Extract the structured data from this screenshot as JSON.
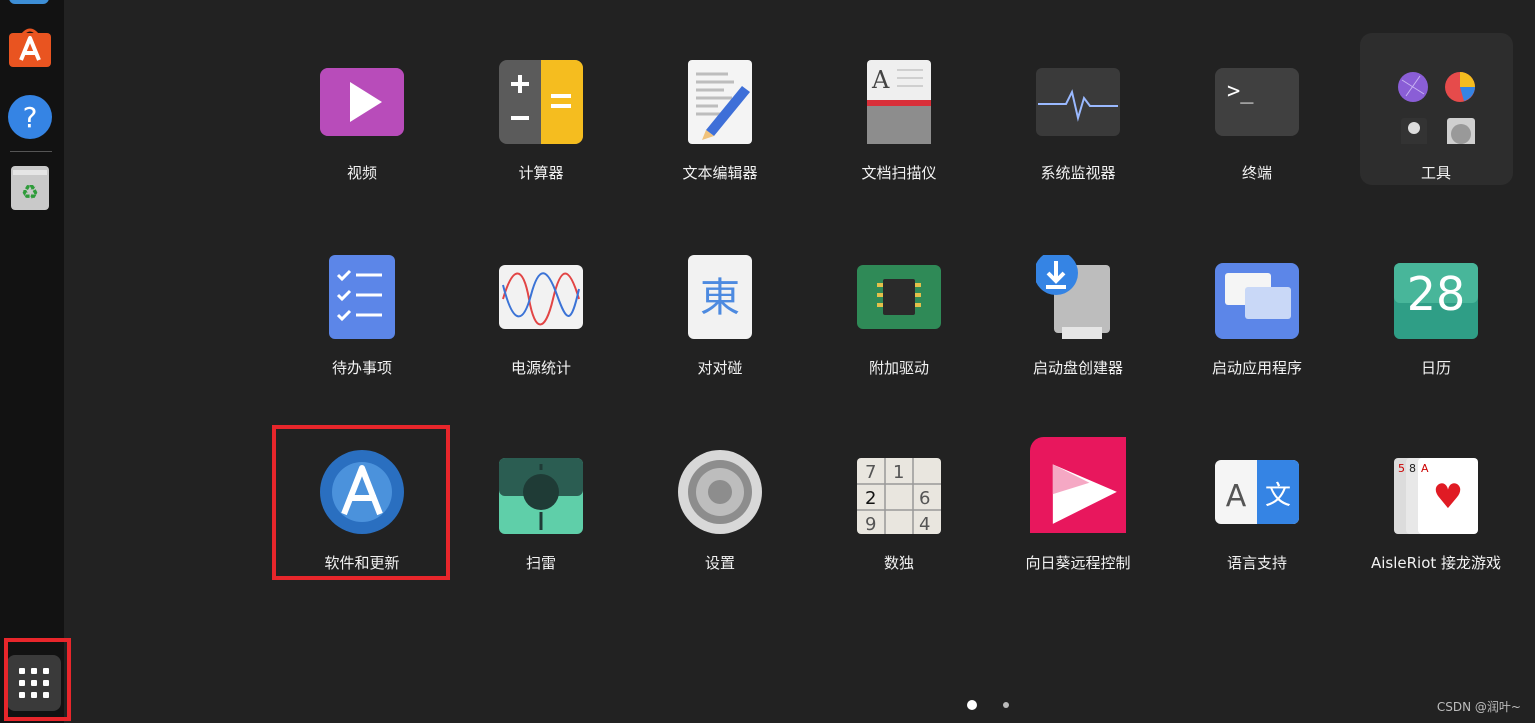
{
  "dock": {
    "items": [
      "ubuntu-software-icon",
      "help-icon",
      "trash-icon"
    ],
    "show_apps": "show-applications-icon"
  },
  "apps": [
    {
      "label": "视频",
      "icon": "video-player-icon"
    },
    {
      "label": "计算器",
      "icon": "calculator-icon"
    },
    {
      "label": "文本编辑器",
      "icon": "text-editor-icon"
    },
    {
      "label": "文档扫描仪",
      "icon": "document-scanner-icon"
    },
    {
      "label": "系统监视器",
      "icon": "system-monitor-icon"
    },
    {
      "label": "终端",
      "icon": "terminal-icon"
    },
    {
      "label": "工具",
      "icon": "utilities-folder-icon"
    },
    {
      "label": "待办事项",
      "icon": "todo-icon"
    },
    {
      "label": "电源统计",
      "icon": "power-statistics-icon"
    },
    {
      "label": "对对碰",
      "icon": "mahjongg-icon"
    },
    {
      "label": "附加驱动",
      "icon": "additional-drivers-icon"
    },
    {
      "label": "启动盘创建器",
      "icon": "startup-disk-creator-icon"
    },
    {
      "label": "启动应用程序",
      "icon": "startup-applications-icon"
    },
    {
      "label": "日历",
      "icon": "calendar-icon",
      "day": "28"
    },
    {
      "label": "软件和更新",
      "icon": "software-updates-icon"
    },
    {
      "label": "扫雷",
      "icon": "mines-icon"
    },
    {
      "label": "设置",
      "icon": "settings-gear-icon"
    },
    {
      "label": "数独",
      "icon": "sudoku-icon"
    },
    {
      "label": "向日葵远程控制",
      "icon": "sunlogin-remote-icon"
    },
    {
      "label": "语言支持",
      "icon": "language-support-icon"
    },
    {
      "label": "AisleRiot 接龙游戏",
      "icon": "aisleriot-cards-icon"
    }
  ],
  "pagination": {
    "pages": 2,
    "current": 1
  },
  "watermark": "CSDN @润叶~",
  "colors": {
    "highlight": "#e8262b",
    "background": "#222222",
    "dock": "#121212"
  }
}
